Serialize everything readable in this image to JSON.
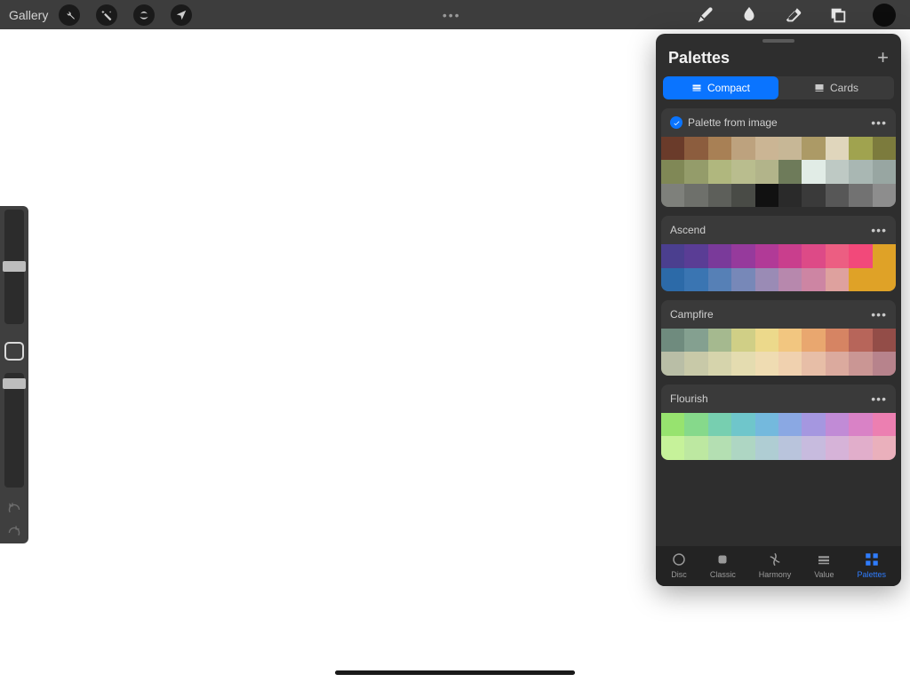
{
  "toolbar": {
    "gallery": "Gallery"
  },
  "panel": {
    "title": "Palettes",
    "seg": {
      "compact": "Compact",
      "cards": "Cards"
    },
    "palettes": [
      {
        "name": "Palette from image",
        "default": true,
        "colors": [
          "#6a3b2a",
          "#8c5d3e",
          "#a88055",
          "#bda27e",
          "#cbb594",
          "#c7b796",
          "#ac9a66",
          "#e0d6bc",
          "#a0a34f",
          "#7c7b3d",
          "#808856",
          "#949c6a",
          "#b0b77e",
          "#b9bd8e",
          "#b2b48a",
          "#6e7b5a",
          "#e1ece6",
          "#bec9c4",
          "#a9b7b3",
          "#98a6a2",
          "#7e807b",
          "#6e706b",
          "#5d5f5a",
          "#494b46",
          "#111111",
          "#2a2a2a",
          "#3a3a3a",
          "#575757",
          "#727272",
          "#8d8d8d"
        ]
      },
      {
        "name": "Ascend",
        "default": false,
        "colors": [
          "#4b3f8f",
          "#5a3d95",
          "#7a3a9a",
          "#963a9c",
          "#b13a97",
          "#c93e8d",
          "#dd4a87",
          "#ec5e82",
          "#f2497a",
          "#dfa227",
          "#2c6aa8",
          "#3a75b2",
          "#5680b6",
          "#7788b8",
          "#9a8bb5",
          "#b788ad",
          "#cd85a3",
          "#dea19e",
          "#dfa227",
          "#dfa227"
        ]
      },
      {
        "name": "Campfire",
        "default": false,
        "colors": [
          "#6f8b7e",
          "#84a090",
          "#a5b98f",
          "#d0cf86",
          "#ecd98b",
          "#f2c680",
          "#e9a76f",
          "#d68463",
          "#b7655a",
          "#934d48",
          "#b9bea6",
          "#c8c9a8",
          "#d6d4ac",
          "#e4dcb0",
          "#efdcb2",
          "#f0d1af",
          "#e7bea7",
          "#dbaa9e",
          "#ca9694",
          "#b7838c"
        ]
      },
      {
        "name": "Flourish",
        "default": false,
        "colors": [
          "#97e36f",
          "#86d98b",
          "#77cfb0",
          "#6fc6cb",
          "#74b9dd",
          "#8aa8e3",
          "#a597e0",
          "#c18bd6",
          "#d982c6",
          "#ec7fb1",
          "#c6f29a",
          "#bde8a1",
          "#b4dfb2",
          "#aed6c3",
          "#afcdd3",
          "#b9c4dc",
          "#c7bbde",
          "#d6b3d8",
          "#e1aecb",
          "#eab0bc"
        ]
      }
    ],
    "tabs": {
      "disc": "Disc",
      "classic": "Classic",
      "harmony": "Harmony",
      "value": "Value",
      "palettes": "Palettes"
    }
  }
}
